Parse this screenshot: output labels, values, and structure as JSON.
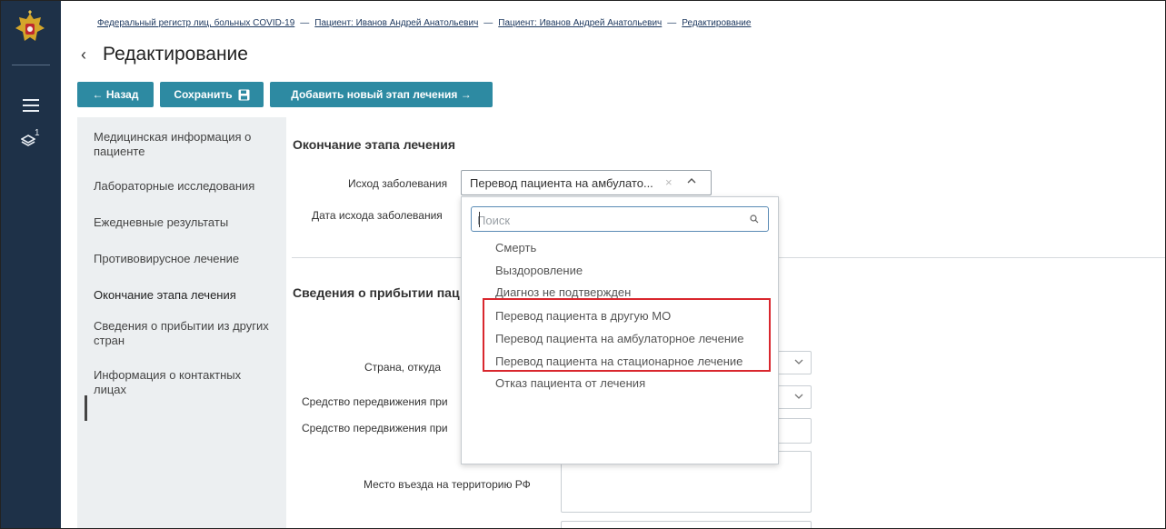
{
  "breadcrumb": [
    "Федеральный регистр лиц, больных COVID-19",
    "Пациент: Иванов Андрей Анатольевич",
    "Пациент: Иванов Андрей Анатольевич",
    "Редактирование"
  ],
  "breadcrumb_sep": "—",
  "page_title": "Редактирование",
  "toolbar": {
    "back_label": "← Назад",
    "save_label": "Сохранить",
    "add_stage_label": "Добавить новый этап лечения →"
  },
  "rail": {
    "layers_badge": "1"
  },
  "nav": {
    "items": [
      "Медицинская информация о пациенте",
      "Лабораторные исследования",
      "Ежедневные результаты",
      "Противовирусное лечение",
      "Окончание этапа лечения",
      "Сведения о прибытии из других стран",
      "Информация о контактных лицах"
    ],
    "active_index": 4
  },
  "section1": {
    "title": "Окончание этапа лечения",
    "outcome_label": "Исход заболевания",
    "outcome_value": "Перевод пациента на амбулато...",
    "outcome_date_label": "Дата исхода заболевания"
  },
  "section2": {
    "title": "Сведения о прибытии пац",
    "country_label": "Страна, откуда",
    "transport_label_1": "Средство передвижения при",
    "transport_label_2": "Средство передвижения при",
    "entry_place_label": "Место въезда на территорию РФ"
  },
  "dropdown": {
    "search_placeholder": "Поиск",
    "options": [
      "Смерть",
      "Выздоровление",
      "Диагноз не подтвержден",
      "Перевод пациента в другую МО",
      "Перевод пациента на амбулаторное лечение",
      "Перевод пациента на стационарное лечение",
      "Отказ пациента от лечения"
    ],
    "highlight_color": "#d9272e"
  },
  "colors": {
    "rail": "#1e3148",
    "button": "#2d8aa2",
    "nav_bg": "#eceff1"
  }
}
